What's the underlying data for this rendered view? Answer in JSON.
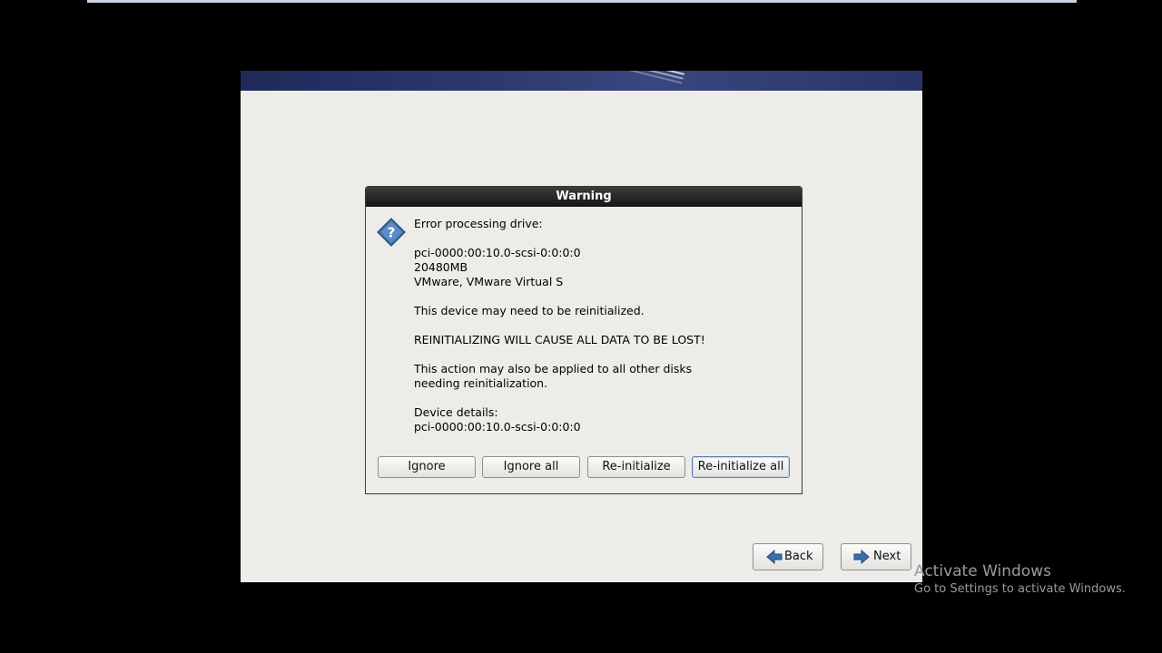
{
  "dialog": {
    "title": "Warning",
    "message": "Error processing drive:\n\npci-0000:00:10.0-scsi-0:0:0:0\n20480MB\nVMware, VMware Virtual S\n\nThis device may need to be reinitialized.\n\nREINITIALIZING WILL CAUSE ALL DATA TO BE LOST!\n\nThis action may also be applied to all other disks\nneeding reinitialization.\n\nDevice details:\npci-0000:00:10.0-scsi-0:0:0:0",
    "icon": "question-icon",
    "buttons": {
      "ignore": "Ignore",
      "ignore_all": "Ignore all",
      "reinitialize": "Re-initialize",
      "reinitialize_all": "Re-initialize all"
    }
  },
  "nav": {
    "back_label": "Back",
    "next_label": "Next",
    "back_icon": "arrow-left-icon",
    "next_icon": "arrow-right-icon"
  },
  "watermark": {
    "title": "Activate Windows",
    "subtitle": "Go to Settings to activate Windows."
  },
  "colors": {
    "background": "#000000",
    "installer_panel": "#edece8",
    "banner": "#2e3a70",
    "dialog_titlebar": "#1e1e1e",
    "icon_blue": "#3d6ea8"
  }
}
